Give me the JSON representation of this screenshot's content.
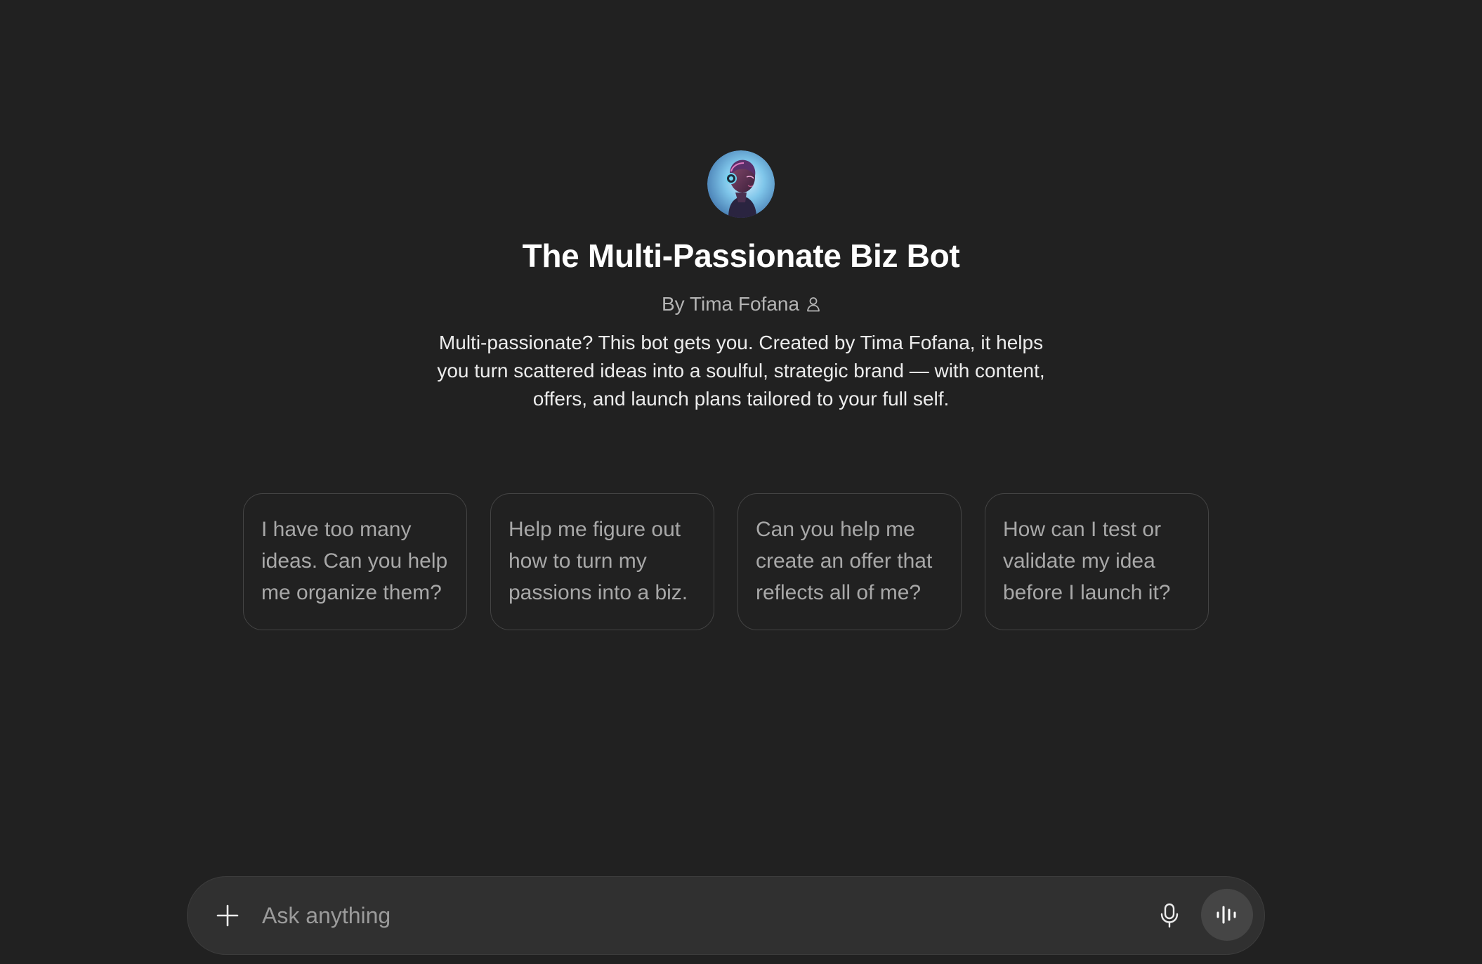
{
  "gpt": {
    "title": "The Multi-Passionate Biz Bot",
    "byline": "By Tima Fofana",
    "description": "Multi-passionate? This bot gets you. Created by Tima Fofana, it helps you turn scattered ideas into a soulful, strategic brand — with content, offers, and launch plans tailored to your full self."
  },
  "icons": {
    "author": "person-icon",
    "attach": "plus-icon",
    "dictate": "microphone-icon",
    "voice": "voice-waveform-icon"
  },
  "starters": [
    {
      "label": "I have too many ideas. Can you help me organize them?"
    },
    {
      "label": "Help me figure out how to turn my passions into a biz."
    },
    {
      "label": "Can you help me create an offer that reflects all of me?"
    },
    {
      "label": "How can I test or validate my idea before I launch it?"
    }
  ],
  "composer": {
    "placeholder": "Ask anything"
  },
  "colors": {
    "background": "#212121",
    "composer": "#303030",
    "card_border": "#444444",
    "voice_button": "#454545"
  }
}
